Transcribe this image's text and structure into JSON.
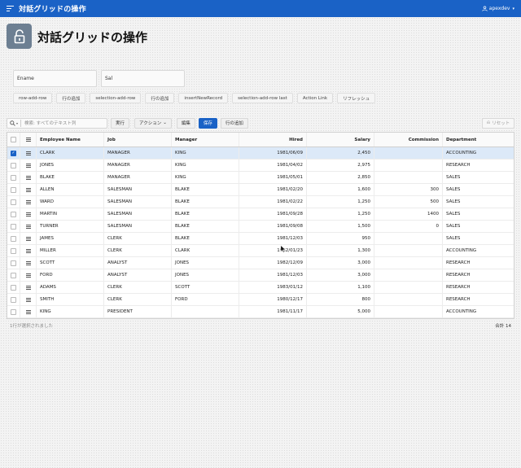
{
  "header": {
    "app_title": "対話グリッドの操作",
    "user_name": "apexdev"
  },
  "page": {
    "title": "対話グリッドの操作"
  },
  "form": {
    "ename_label": "Ename",
    "sal_label": "Sal",
    "buttons": [
      "row-add-row",
      "行の追加",
      "selection-add-row",
      "行の追加",
      "insertNewRecord",
      "selection-add-row last",
      "Action Link",
      "リフレッシュ"
    ]
  },
  "toolbar": {
    "search_placeholder": "検索: すべてのテキスト列",
    "go_label": "実行",
    "actions_label": "アクション",
    "edit_label": "編集",
    "save_label": "保存",
    "add_row_label": "行の追加",
    "reset_label": "リセット"
  },
  "grid": {
    "columns": [
      "Employee Name",
      "Job",
      "Manager",
      "Hired",
      "Salary",
      "Commission",
      "Department"
    ],
    "rows": [
      [
        "CLARK",
        "MANAGER",
        "KING",
        "1981/06/09",
        "2,450",
        "",
        "ACCOUNTING"
      ],
      [
        "JONES",
        "MANAGER",
        "KING",
        "1981/04/02",
        "2,975",
        "",
        "RESEARCH"
      ],
      [
        "BLAKE",
        "MANAGER",
        "KING",
        "1981/05/01",
        "2,850",
        "",
        "SALES"
      ],
      [
        "ALLEN",
        "SALESMAN",
        "BLAKE",
        "1981/02/20",
        "1,600",
        "300",
        "SALES"
      ],
      [
        "WARD",
        "SALESMAN",
        "BLAKE",
        "1981/02/22",
        "1,250",
        "500",
        "SALES"
      ],
      [
        "MARTIN",
        "SALESMAN",
        "BLAKE",
        "1981/09/28",
        "1,250",
        "1400",
        "SALES"
      ],
      [
        "TURNER",
        "SALESMAN",
        "BLAKE",
        "1981/09/08",
        "1,500",
        "0",
        "SALES"
      ],
      [
        "JAMES",
        "CLERK",
        "BLAKE",
        "1981/12/03",
        "950",
        "",
        "SALES"
      ],
      [
        "MILLER",
        "CLERK",
        "CLARK",
        "1982/01/23",
        "1,300",
        "",
        "ACCOUNTING"
      ],
      [
        "SCOTT",
        "ANALYST",
        "JONES",
        "1982/12/09",
        "3,000",
        "",
        "RESEARCH"
      ],
      [
        "FORD",
        "ANALYST",
        "JONES",
        "1981/12/03",
        "3,000",
        "",
        "RESEARCH"
      ],
      [
        "ADAMS",
        "CLERK",
        "SCOTT",
        "1983/01/12",
        "1,100",
        "",
        "RESEARCH"
      ],
      [
        "SMITH",
        "CLERK",
        "FORD",
        "1980/12/17",
        "800",
        "",
        "RESEARCH"
      ],
      [
        "KING",
        "PRESIDENT",
        "",
        "1981/11/17",
        "5,000",
        "",
        "ACCOUNTING"
      ]
    ],
    "selected_row": 0,
    "selection_status": "1行が選択されました",
    "total_label": "合計 14"
  },
  "colors": {
    "brand": "#1a62c6",
    "selected_row": "#dce9f8",
    "page_icon": "#6d7f92"
  }
}
